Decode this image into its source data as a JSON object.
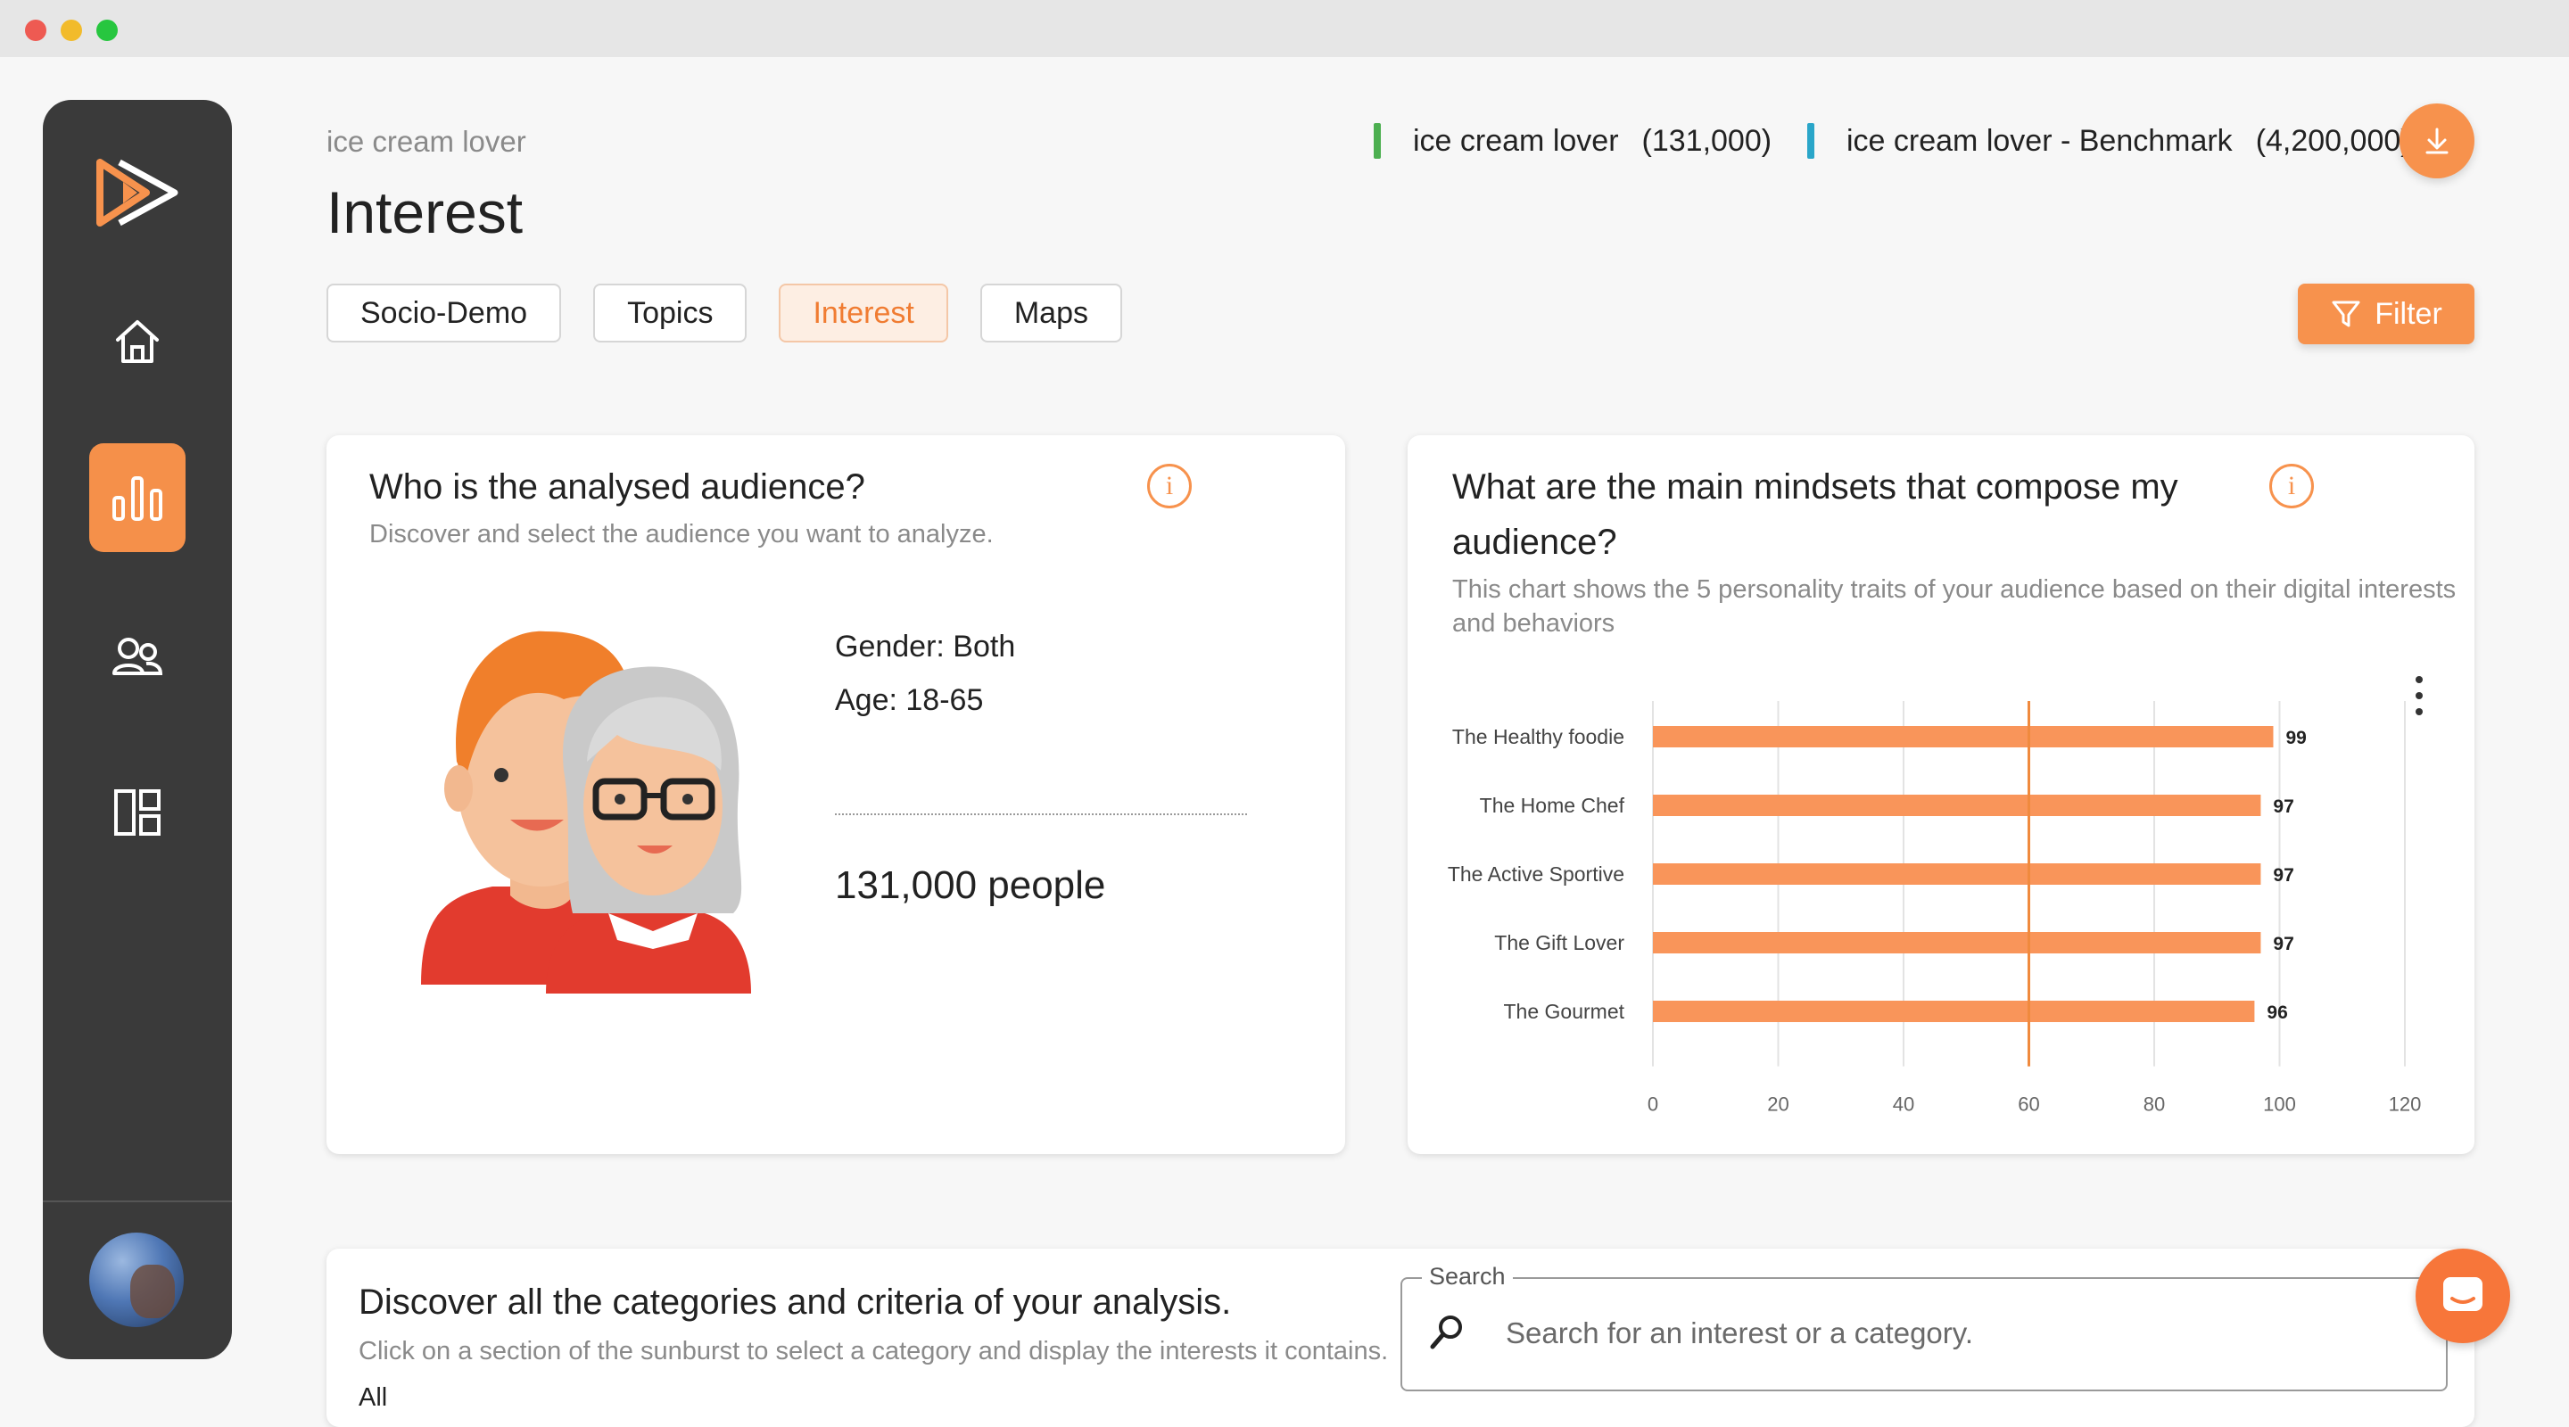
{
  "app": {
    "breadcrumb": "ice cream lover",
    "page_title": "Interest"
  },
  "tabs": [
    {
      "label": "Socio-Demo",
      "active": false
    },
    {
      "label": "Topics",
      "active": false
    },
    {
      "label": "Interest",
      "active": true
    },
    {
      "label": "Maps",
      "active": false
    }
  ],
  "legend": {
    "audience": {
      "label": "ice cream lover",
      "count": "(131,000)",
      "color": "#4caf50"
    },
    "benchmark": {
      "label": "ice cream lover - Benchmark",
      "count": "(4,200,000)",
      "color": "#2aa6c9"
    }
  },
  "filter_label": "Filter",
  "audience_card": {
    "title": "Who is the analysed audience?",
    "subtitle": "Discover and select the audience you want to analyze.",
    "gender": "Gender: Both",
    "age": "Age: 18-65",
    "people": "131,000 people"
  },
  "mindsets_card": {
    "title_line1": "What are the main mindsets that compose my",
    "title_line2": "audience?",
    "subtitle_line1": "This chart shows the 5 personality traits of your audience based on their digital interests",
    "subtitle_line2": "and behaviors"
  },
  "chart_data": {
    "type": "bar",
    "orientation": "horizontal",
    "categories": [
      "The Healthy foodie",
      "The Home Chef",
      "The Active Sportive",
      "The Gift Lover",
      "The Gourmet"
    ],
    "values": [
      99,
      97,
      97,
      97,
      96
    ],
    "xlim": [
      0,
      120
    ],
    "xticks": [
      0,
      20,
      40,
      60,
      80,
      100,
      120
    ],
    "bar_color": "#f9955a",
    "reference_line": 60,
    "grid": true
  },
  "discover_card": {
    "title": "Discover all the categories and criteria of your analysis.",
    "subtitle": "Click on a section of the sunburst to select a category and display the interests it contains.",
    "partial_text": "All"
  },
  "search": {
    "label": "Search",
    "placeholder": "Search for an interest or a category."
  },
  "colors": {
    "accent": "#f7924d",
    "sidebar": "#3a3a3a"
  }
}
